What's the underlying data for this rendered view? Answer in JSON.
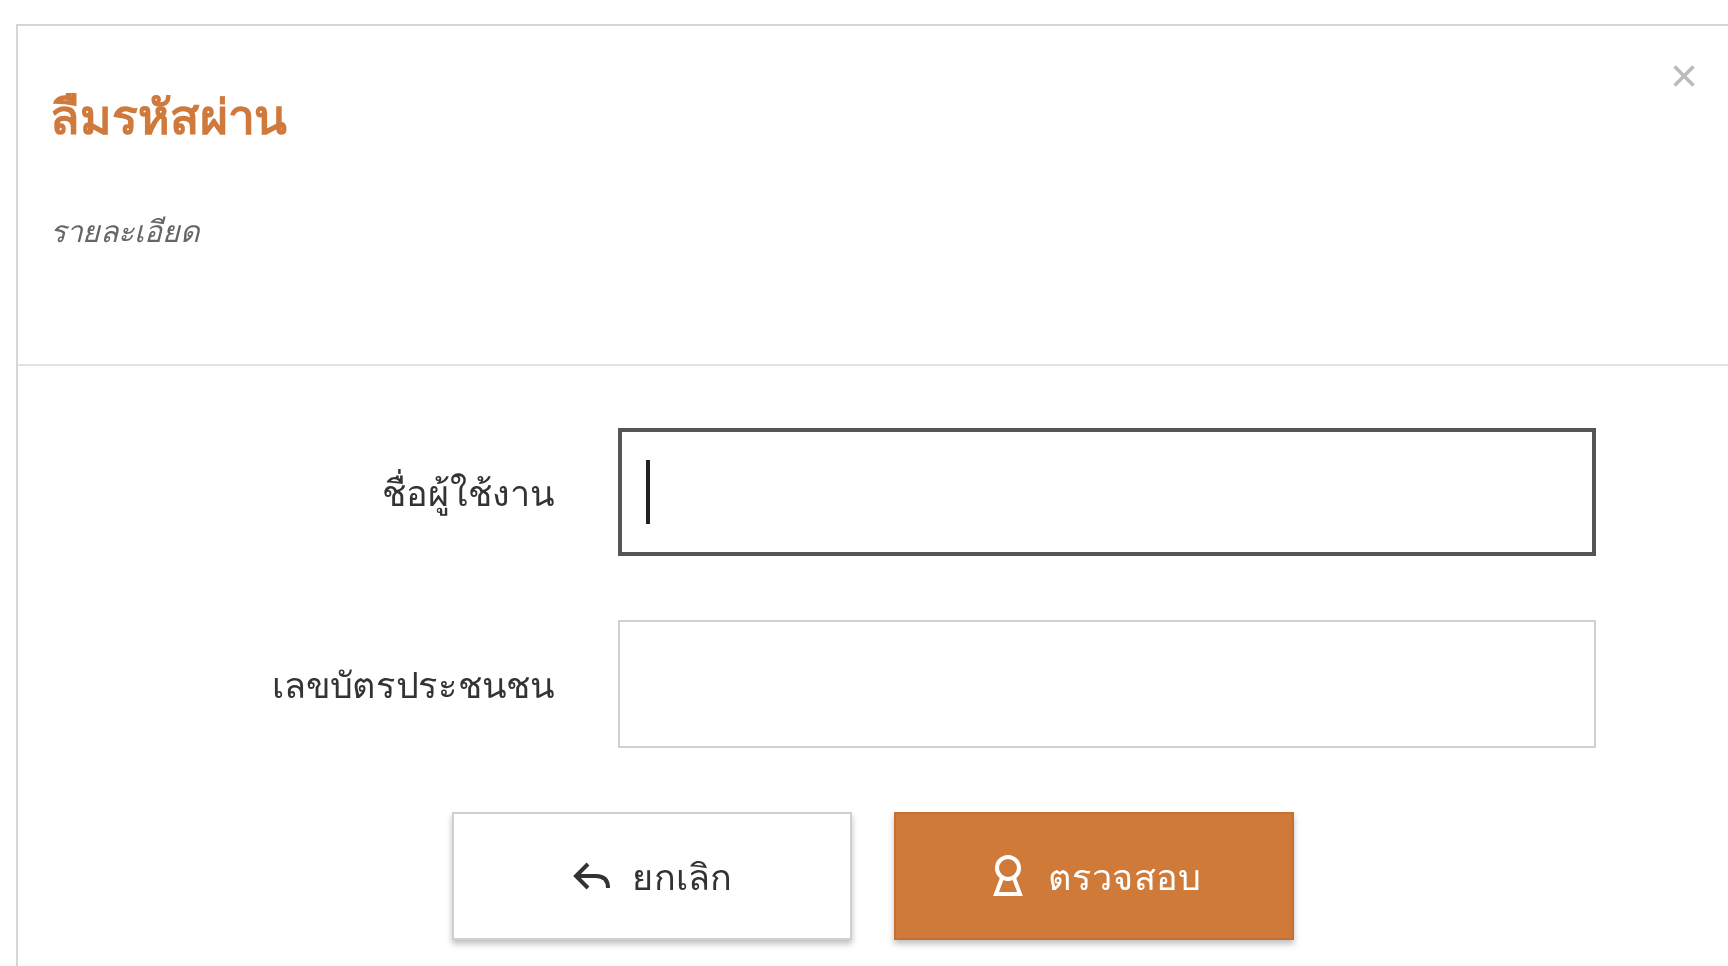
{
  "dialog": {
    "title": "ลืมรหัสผ่าน",
    "subtitle": "รายละเอียด",
    "close": "×"
  },
  "fields": [
    {
      "label": "ชื่อผู้ใช้งาน",
      "focused": true
    },
    {
      "label": "เลขบัตรประชนชน",
      "focused": false
    }
  ],
  "buttons": [
    {
      "kind": "cancel",
      "label": "ยกเลิก"
    },
    {
      "kind": "check",
      "label": "ตรวจสอบ"
    }
  ]
}
